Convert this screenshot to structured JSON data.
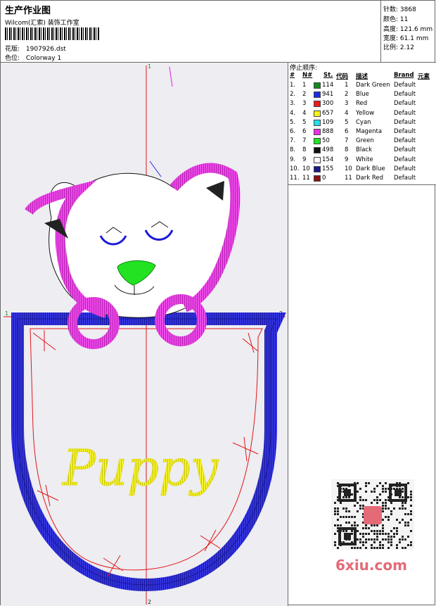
{
  "header": {
    "title": "生产作业图",
    "company": "Wilcom(汇索) 装饰工作室",
    "file_label": "花版:",
    "file_name": "1907926.dst",
    "colorway_label": "色位:",
    "colorway_name": "Colorway 1"
  },
  "stats": [
    {
      "label": "针数:",
      "value": "3868"
    },
    {
      "label": "颜色:",
      "value": "11"
    },
    {
      "label": "高度:",
      "value": "121.6 mm"
    },
    {
      "label": "宽度:",
      "value": "61.1 mm"
    },
    {
      "label": "比例:",
      "value": "2.12"
    }
  ],
  "table": {
    "caption": "停止顺序:",
    "headers": [
      "#",
      "N#",
      "St.",
      "代码",
      "描述",
      "Brand",
      "元素"
    ],
    "rows": [
      {
        "idx": "1.",
        "n": "1",
        "color": "#128a1e",
        "st": "114",
        "code": "1",
        "desc": "Dark Green",
        "brand": "Default"
      },
      {
        "idx": "2.",
        "n": "2",
        "color": "#1a2ee6",
        "st": "941",
        "code": "2",
        "desc": "Blue",
        "brand": "Default"
      },
      {
        "idx": "3.",
        "n": "3",
        "color": "#ee1b1b",
        "st": "300",
        "code": "3",
        "desc": "Red",
        "brand": "Default"
      },
      {
        "idx": "4.",
        "n": "4",
        "color": "#f7f21a",
        "st": "657",
        "code": "4",
        "desc": "Yellow",
        "brand": "Default"
      },
      {
        "idx": "5.",
        "n": "5",
        "color": "#23e0ee",
        "st": "109",
        "code": "5",
        "desc": "Cyan",
        "brand": "Default"
      },
      {
        "idx": "6.",
        "n": "6",
        "color": "#ee2ee8",
        "st": "888",
        "code": "6",
        "desc": "Magenta",
        "brand": "Default"
      },
      {
        "idx": "7.",
        "n": "7",
        "color": "#1ee81e",
        "st": "50",
        "code": "7",
        "desc": "Green",
        "brand": "Default"
      },
      {
        "idx": "8.",
        "n": "8",
        "color": "#111111",
        "st": "498",
        "code": "8",
        "desc": "Black",
        "brand": "Default"
      },
      {
        "idx": "9.",
        "n": "9",
        "color": "#ffffff",
        "st": "154",
        "code": "9",
        "desc": "White",
        "brand": "Default"
      },
      {
        "idx": "10.",
        "n": "10",
        "color": "#1a1a8a",
        "st": "155",
        "code": "10",
        "desc": "Dark Blue",
        "brand": "Default"
      },
      {
        "idx": "11.",
        "n": "11",
        "color": "#8a1010",
        "st": "0",
        "code": "11",
        "desc": "Dark Red",
        "brand": "Default"
      }
    ]
  },
  "design": {
    "text": "Puppy",
    "axis_marks": [
      "1",
      "2",
      "1",
      "2"
    ],
    "colors": {
      "blue": "#2a2ad8",
      "magenta": "#e83ee4",
      "yellow": "#f4f024",
      "green": "#22e222",
      "red": "#e21616",
      "black": "#111111"
    }
  },
  "watermark": {
    "site": "6xiu.com"
  }
}
